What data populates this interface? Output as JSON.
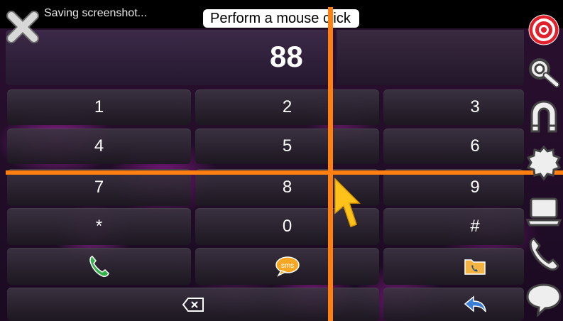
{
  "status_bar": {
    "text": "Saving screenshot..."
  },
  "tooltip": {
    "text": "Perform a mouse click"
  },
  "display": {
    "number": "88"
  },
  "keypad": {
    "rows": [
      [
        "1",
        "2",
        "3"
      ],
      [
        "4",
        "5",
        "6"
      ],
      [
        "7",
        "8",
        "9"
      ],
      [
        "*",
        "0",
        "#"
      ]
    ]
  },
  "actions": {
    "call_icon": "phone-call-icon",
    "sms_icon": "sms-bubble-icon",
    "contacts_icon": "folder-phone-icon",
    "backspace_icon": "backspace-icon",
    "back_icon": "reply-arrow-icon"
  },
  "sidebar": {
    "icons": [
      "target-icon",
      "magnifier-icon",
      "magnet-icon",
      "gear-icon",
      "laptop-icon",
      "phone-icon",
      "speech-bubble-icon"
    ]
  },
  "colors": {
    "overlay_grid": "#ff7f10",
    "cursor": "#ffc21a",
    "call_green": "#34b24a",
    "sms_orange": "#f5a623",
    "back_blue": "#3a7ed6",
    "target_red": "#e0202a"
  }
}
